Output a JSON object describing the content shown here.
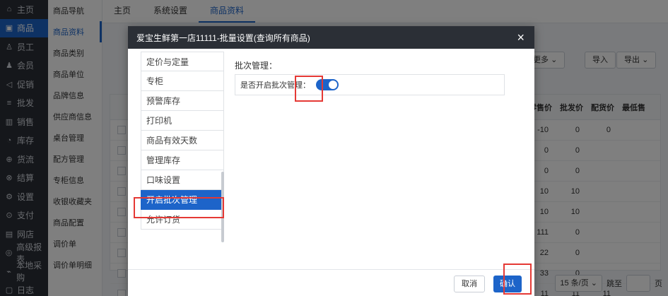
{
  "sidebar": {
    "items": [
      {
        "label": "主页",
        "icon": "home-icon",
        "glyph": "⌂"
      },
      {
        "label": "商品",
        "icon": "product-icon",
        "glyph": "▣",
        "active": true
      },
      {
        "label": "员工",
        "icon": "staff-icon",
        "glyph": "♙"
      },
      {
        "label": "会员",
        "icon": "member-icon",
        "glyph": "♟"
      },
      {
        "label": "促销",
        "icon": "promotion-icon",
        "glyph": "◁"
      },
      {
        "label": "批发",
        "icon": "wholesale-icon",
        "glyph": "≡"
      },
      {
        "label": "销售",
        "icon": "sales-icon",
        "glyph": "▥"
      },
      {
        "label": "库存",
        "icon": "stock-icon",
        "glyph": "◔"
      },
      {
        "label": "货流",
        "icon": "flow-icon",
        "glyph": "⊕"
      },
      {
        "label": "结算",
        "icon": "settle-icon",
        "glyph": "⊗"
      },
      {
        "label": "设置",
        "icon": "settings-icon",
        "glyph": "⚙"
      },
      {
        "label": "支付",
        "icon": "pay-icon",
        "glyph": "⊙"
      },
      {
        "label": "网店",
        "icon": "shop-icon",
        "glyph": "▤"
      },
      {
        "label": "高级报表",
        "icon": "report-icon",
        "glyph": "◎"
      },
      {
        "label": "本地采购",
        "icon": "purchase-icon",
        "glyph": "⌁"
      },
      {
        "label": "日志",
        "icon": "log-icon",
        "glyph": "▢"
      }
    ]
  },
  "submenu": {
    "items": [
      {
        "label": "商品导航"
      },
      {
        "label": "商品资料",
        "active": true
      },
      {
        "label": "商品类别"
      },
      {
        "label": "商品单位"
      },
      {
        "label": "品牌信息"
      },
      {
        "label": "供应商信息"
      },
      {
        "label": "桌台管理"
      },
      {
        "label": "配方管理"
      },
      {
        "label": "专柜信息"
      },
      {
        "label": "收银收藏夹"
      },
      {
        "label": "商品配置"
      },
      {
        "label": "调价单"
      },
      {
        "label": "调价单明细"
      }
    ]
  },
  "topbar": {
    "tabs": [
      {
        "label": "主页"
      },
      {
        "label": "系统设置"
      },
      {
        "label": "商品资料",
        "active": true
      }
    ]
  },
  "background": {
    "more_label": "更多",
    "import_label": "导入",
    "export_label": "导出",
    "columns": [
      "零售价",
      "批发价",
      "配货价",
      "最低售"
    ],
    "rows": [
      [
        "-10",
        "0",
        "0"
      ],
      [
        "0",
        "0",
        ""
      ],
      [
        "0",
        "0",
        ""
      ],
      [
        "10",
        "10",
        ""
      ],
      [
        "10",
        "10",
        ""
      ],
      [
        "111",
        "0",
        ""
      ],
      [
        "22",
        "0",
        ""
      ],
      [
        "33",
        "0",
        ""
      ],
      [
        "11",
        "11",
        "11"
      ]
    ],
    "pager": {
      "page_size": "15 条/页",
      "goto": "跳至",
      "page_unit": "页"
    }
  },
  "modal": {
    "title": "爱宝生鲜第一店11111-批量设置(查询所有商品)",
    "close_glyph": "×",
    "menu": [
      {
        "label": "定价与定量"
      },
      {
        "label": "专柜"
      },
      {
        "label": "预警库存"
      },
      {
        "label": "打印机"
      },
      {
        "label": "商品有效天数"
      },
      {
        "label": "管理库存"
      },
      {
        "label": "口味设置"
      },
      {
        "label": "开启批次管理",
        "active": true
      },
      {
        "label": "允许订货"
      }
    ],
    "section_title": "批次管理：",
    "setting_label": "是否开启批次管理：",
    "toggle_on": true,
    "cancel_label": "取消",
    "confirm_label": "确认",
    "accent": "#1d64c9",
    "highlight": "#e53935"
  }
}
